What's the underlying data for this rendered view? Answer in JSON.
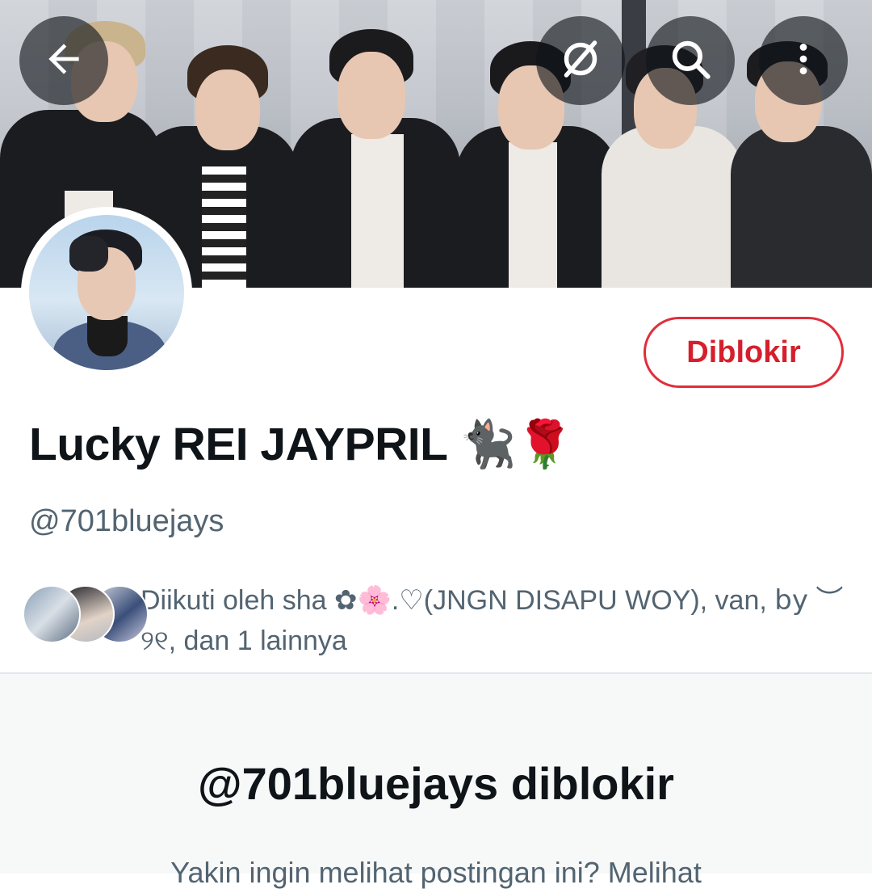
{
  "profile": {
    "display_name": "Lucky REI JAYPRIL 🐈‍⬛🌹",
    "handle": "@701bluejays",
    "blocked_button_label": "Diblokir"
  },
  "followers": {
    "text": "Diikuti oleh sha ✿🌸.♡(JNGN DISAPU WOY), van, 𝖻𝗒 ︶୨୧, dan 1 lainnya"
  },
  "blocked_notice": {
    "title": "@701bluejays diblokir",
    "subtitle": "Yakin ingin melihat postingan ini? Melihat"
  },
  "icons": {
    "back": "arrow-left-icon",
    "grok": "grok-icon",
    "search": "search-icon",
    "more": "more-vertical-icon"
  },
  "colors": {
    "blocked_red": "#e22d3a",
    "secondary_text": "#536471"
  }
}
